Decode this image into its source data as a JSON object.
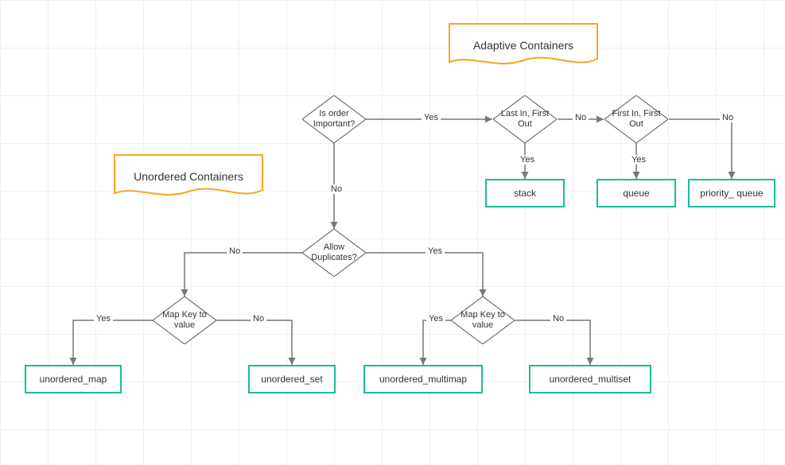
{
  "banners": {
    "adaptive": "Adaptive Containers",
    "unordered": "Unordered Containers"
  },
  "decisions": {
    "order": "Is order Important?",
    "lifo": "Last In, First Out",
    "fifo": "First In, First Out",
    "dup": "Allow Duplicates?",
    "map_left": "Map Key to value",
    "map_right": "Map Key to value"
  },
  "outputs": {
    "stack": "stack",
    "queue": "queue",
    "priority_queue": "priority_ queue",
    "unordered_map": "unordered_map",
    "unordered_set": "unordered_set",
    "unordered_multimap": "unordered_multimap",
    "unordered_multiset": "unordered_multiset"
  },
  "labels": {
    "yes": "Yes",
    "no": "No"
  },
  "colors": {
    "edge": "#777",
    "node_stroke": "#555",
    "accent": "#1abc9c",
    "banner": "#f5a623"
  }
}
